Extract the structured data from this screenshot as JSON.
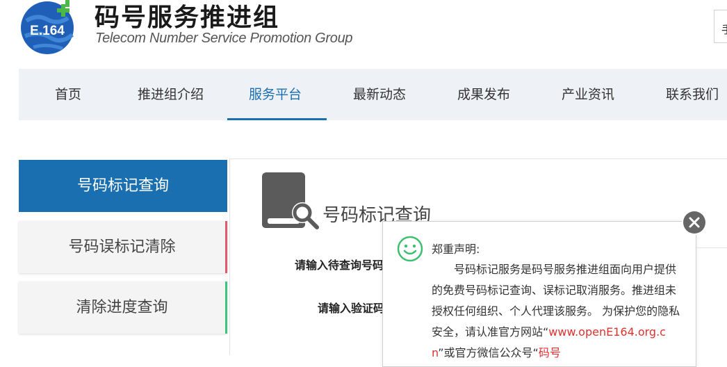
{
  "brand": {
    "logo_text": "E.164",
    "title": "码号服务推进组",
    "subtitle": "Telecom Number Service  Promotion Group"
  },
  "header": {
    "right_button_label": "手"
  },
  "nav": {
    "items": [
      {
        "label": "首页"
      },
      {
        "label": "推进组介绍"
      },
      {
        "label": "服务平台"
      },
      {
        "label": "最新动态"
      },
      {
        "label": "成果发布"
      },
      {
        "label": "产业资讯"
      },
      {
        "label": "联系我们"
      }
    ],
    "active_index": 2
  },
  "sidebar": {
    "items": [
      {
        "label": "号码标记查询"
      },
      {
        "label": "号码误标记清除"
      },
      {
        "label": "清除进度查询"
      }
    ]
  },
  "content": {
    "title": "号码标记查询",
    "label_phone": "请输入待查询号码",
    "label_captcha": "请输入验证码"
  },
  "notice": {
    "title": "郑重声明:",
    "body_1": "号码标记服务是码号服务推进组面向用户提供的免费号码标记查询、误标记取消服务。推进组未授权任何组织、个人代理该服务。 为保护您的隐私安全，请认准官方网站“",
    "link": "www.openE164.org.cn",
    "body_2": "”或官方微信公众号“",
    "link_2": "码号"
  },
  "colors": {
    "accent": "#1a6fb0",
    "nav_bg": "#eef1f5",
    "red_bar": "#e05a6a",
    "green_bar": "#3cc47c",
    "link": "#e03030",
    "notice_icon": "#3cbf6e"
  }
}
